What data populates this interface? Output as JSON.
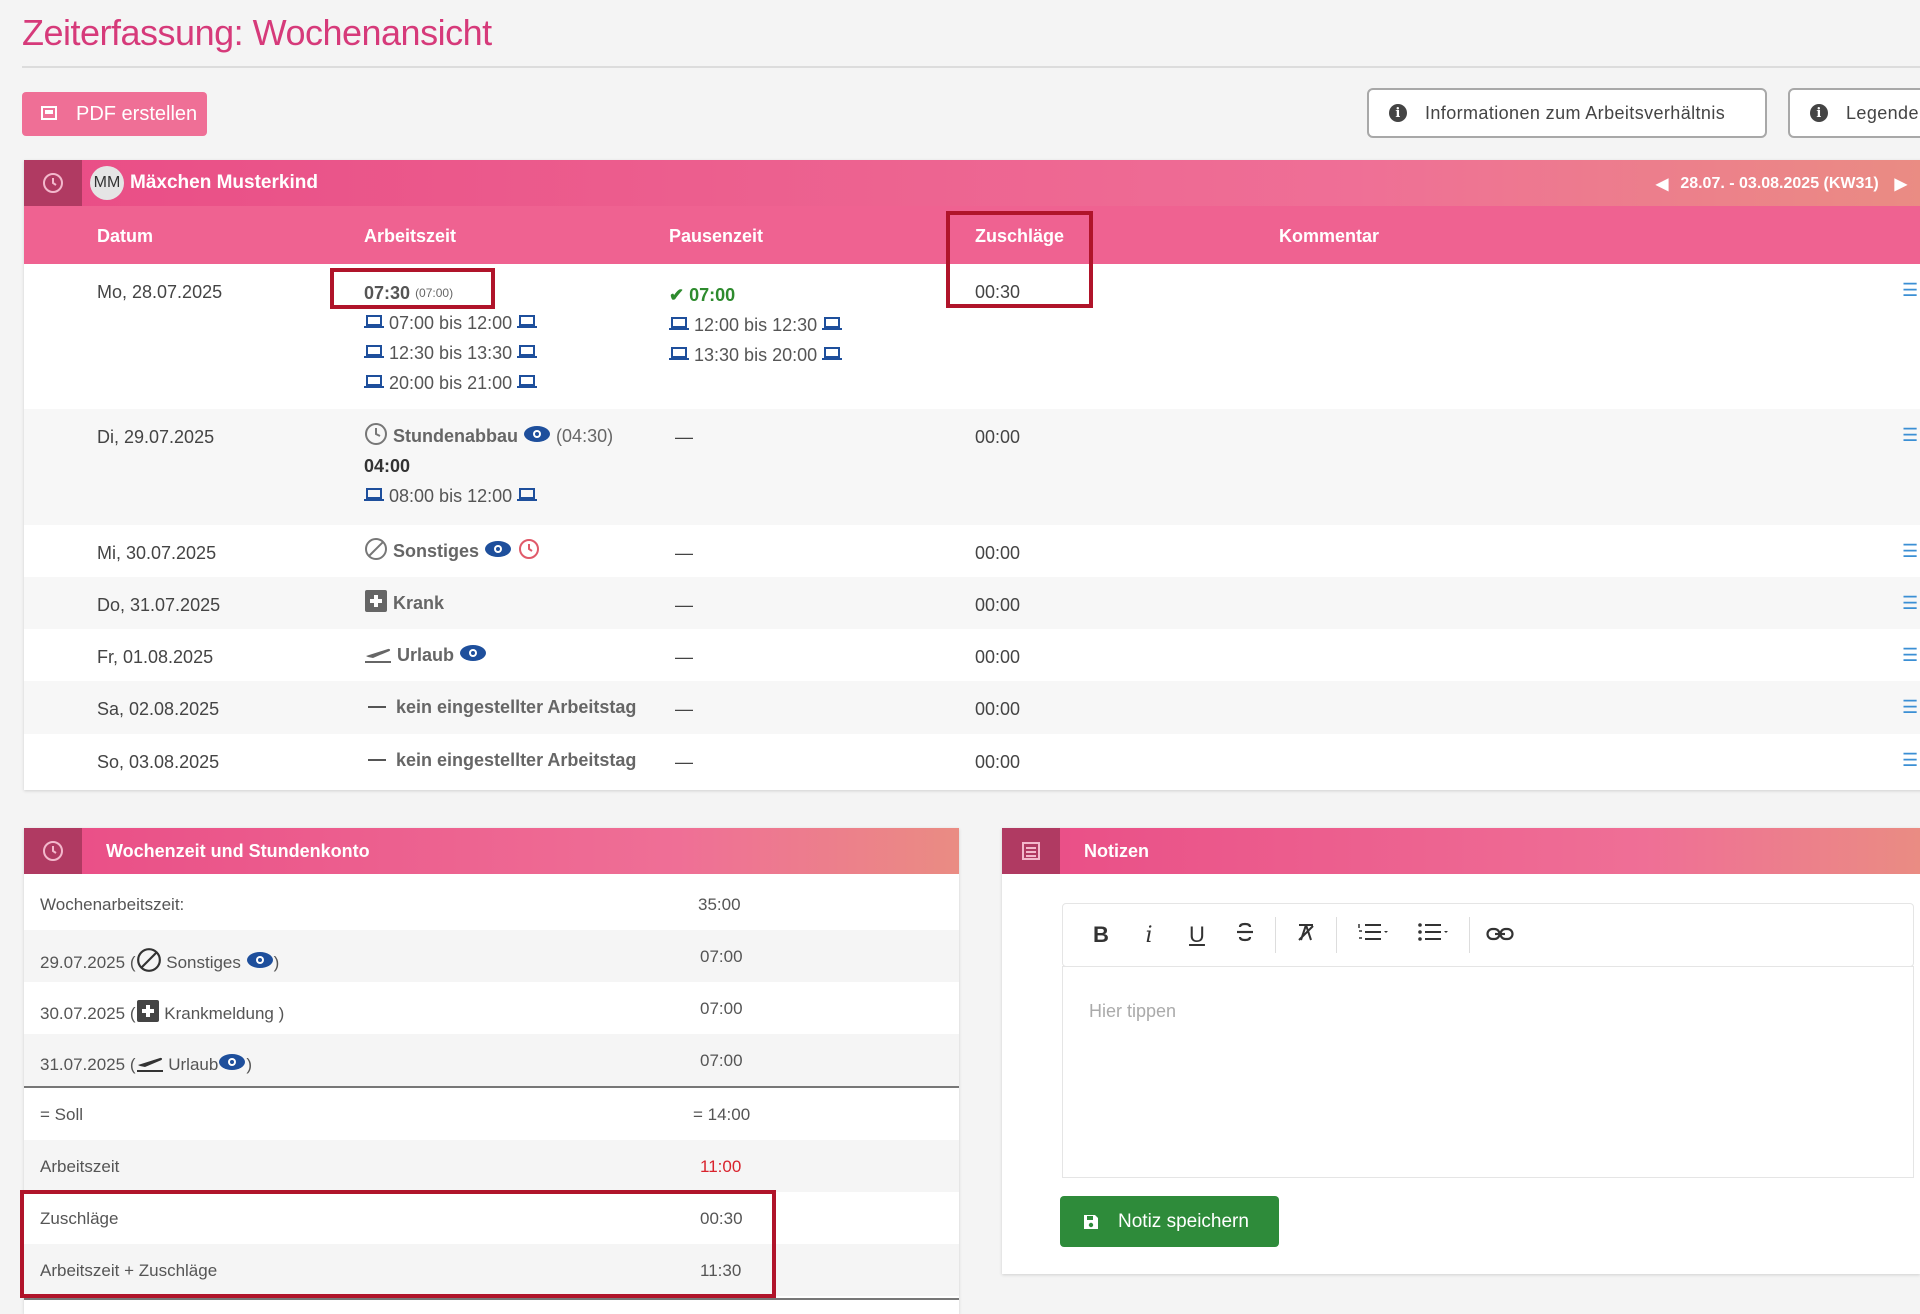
{
  "page": {
    "title": "Zeiterfassung: Wochenansicht"
  },
  "toolbar": {
    "pdf_label": "PDF erstellen",
    "info_label": "Informationen zum Arbeitsverhältnis",
    "legend_label": "Legende"
  },
  "week": {
    "avatar_initials": "MM",
    "employee_name": "Mäxchen Musterkind",
    "range_label": "28.07. - 03.08.2025 (KW31)",
    "columns": {
      "datum": "Datum",
      "arbeitszeit": "Arbeitszeit",
      "pausenzeit": "Pausenzeit",
      "zuschlaege": "Zuschläge",
      "kommentar": "Kommentar"
    },
    "days": [
      {
        "date": "Mo, 28.07.2025",
        "work_total": "07:30",
        "work_target": "(07:00)",
        "intervals": [
          "07:00 bis 12:00",
          "12:30 bis 13:30",
          "20:00 bis 21:00"
        ],
        "pause_total": "07:00",
        "pause_intervals": [
          "12:00 bis 12:30",
          "13:30 bis 20:00"
        ],
        "zuschlag": "00:30"
      },
      {
        "date": "Di, 29.07.2025",
        "absence": "Stundenabbau",
        "absence_extra": "(04:30)",
        "work_total": "04:00",
        "intervals": [
          "08:00 bis 12:00"
        ],
        "pause": "—",
        "zuschlag": "00:00"
      },
      {
        "date": "Mi, 30.07.2025",
        "absence": "Sonstiges",
        "pause": "—",
        "zuschlag": "00:00"
      },
      {
        "date": "Do, 31.07.2025",
        "absence": "Krank",
        "pause": "—",
        "zuschlag": "00:00"
      },
      {
        "date": "Fr, 01.08.2025",
        "absence": "Urlaub",
        "pause": "—",
        "zuschlag": "00:00"
      },
      {
        "date": "Sa, 02.08.2025",
        "absence": "kein eingestellter Arbeitstag",
        "pause": "—",
        "zuschlag": "00:00"
      },
      {
        "date": "So, 03.08.2025",
        "absence": "kein eingestellter Arbeitstag",
        "pause": "—",
        "zuschlag": "00:00"
      }
    ]
  },
  "summary": {
    "title": "Wochenzeit und Stundenkonto",
    "rows": [
      {
        "label": "Wochenarbeitszeit:",
        "value": "35:00"
      },
      {
        "date": "29.07.2025",
        "open": "(",
        "type": "Sonstiges",
        "close": ")",
        "value": "07:00"
      },
      {
        "date": "30.07.2025",
        "open": "(",
        "type": "Krankmeldung",
        "close": ")",
        "value": "07:00"
      },
      {
        "date": "31.07.2025",
        "open": "(",
        "type": "Urlaub",
        "close": ")",
        "value": "07:00"
      },
      {
        "label": "= Soll",
        "value": "= 14:00"
      },
      {
        "label": "Arbeitszeit",
        "value": "11:00"
      },
      {
        "label": "Zuschläge",
        "value": "00:30"
      },
      {
        "label": "Arbeitszeit + Zuschläge",
        "value": "11:30"
      }
    ]
  },
  "notes": {
    "title": "Notizen",
    "placeholder": "Hier tippen",
    "save_label": "Notiz speichern",
    "toolbar": [
      "B",
      "i",
      "U"
    ]
  },
  "colors": {
    "accent": "#ef6291",
    "title": "#d63a7a",
    "highlight": "#b0142a",
    "save": "#2e8b3a",
    "eye": "#1e4f9c"
  }
}
